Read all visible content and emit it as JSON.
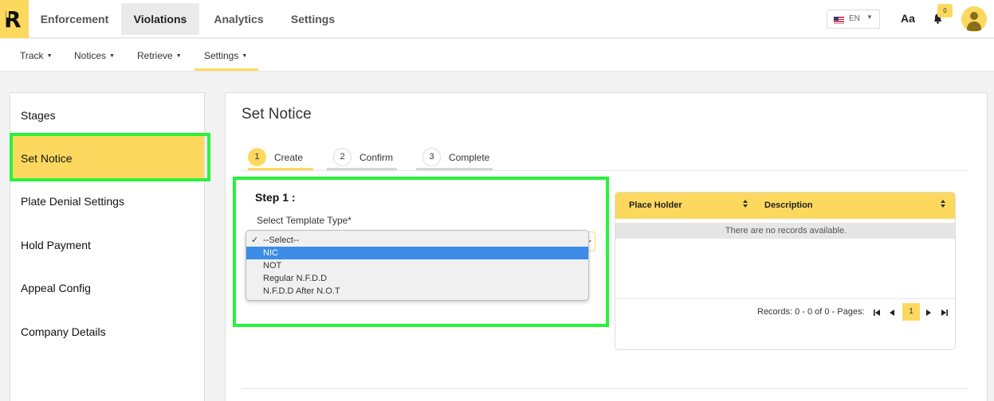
{
  "app": {
    "logo_letter": "R"
  },
  "topnav": {
    "tabs": [
      {
        "label": "Enforcement"
      },
      {
        "label": "Violations",
        "active": true
      },
      {
        "label": "Analytics"
      },
      {
        "label": "Settings"
      }
    ],
    "language": {
      "code": "EN",
      "flag_icon": "us-flag-icon"
    },
    "font_size_icon": "Aa",
    "notification_count": "0"
  },
  "subnav": {
    "items": [
      {
        "label": "Track"
      },
      {
        "label": "Notices"
      },
      {
        "label": "Retrieve"
      },
      {
        "label": "Settings",
        "active": true
      }
    ]
  },
  "sidebar": {
    "items": [
      {
        "label": "Stages"
      },
      {
        "label": "Set Notice",
        "active": true
      },
      {
        "label": "Plate Denial Settings"
      },
      {
        "label": "Hold Payment"
      },
      {
        "label": "Appeal Config"
      },
      {
        "label": "Company Details"
      }
    ]
  },
  "main": {
    "title": "Set Notice",
    "steps": [
      {
        "num": "1",
        "label": "Create",
        "active": true
      },
      {
        "num": "2",
        "label": "Confirm"
      },
      {
        "num": "3",
        "label": "Complete"
      }
    ],
    "step_heading": "Step 1 :",
    "template_label": "Select Template Type*",
    "template_options": [
      {
        "label": "--Select--",
        "selected": true
      },
      {
        "label": "NIC",
        "highlighted": true
      },
      {
        "label": "NOT"
      },
      {
        "label": "Regular N.F.D.D"
      },
      {
        "label": "N.F.D.D After N.O.T"
      }
    ],
    "table": {
      "columns": [
        "Place Holder",
        "Description"
      ],
      "empty_message": "There are no records available.",
      "pager_text": "Records: 0 - 0 of 0 - Pages:",
      "current_page": "1"
    }
  },
  "colors": {
    "accent": "#fcd95e",
    "highlight_box": "#27f33a",
    "option_hover": "#3d8ce8"
  }
}
